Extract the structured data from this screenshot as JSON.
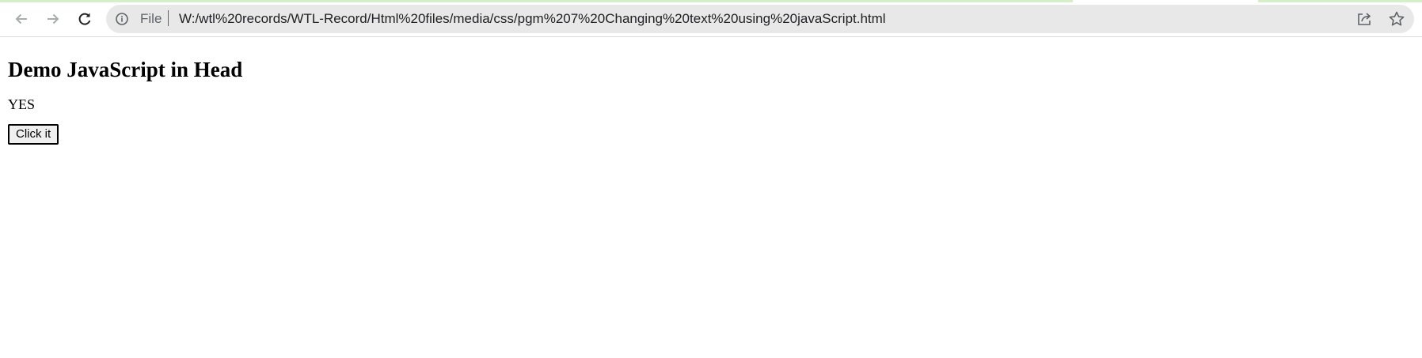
{
  "browser": {
    "address_bar": {
      "scheme_label": "File",
      "url": "W:/wtl%20records/WTL-Record/Html%20files/media/css/pgm%207%20Changing%20text%20using%20javaScript.html"
    },
    "icons": {
      "back": "arrow-left-icon",
      "forward": "arrow-right-icon",
      "reload": "reload-icon",
      "info": "info-icon",
      "share": "share-icon",
      "bookmark": "star-icon"
    },
    "colors": {
      "toolbar_background": "#ffffff",
      "omnibox_background": "#e8e8e8",
      "icon_color": "#5f6368",
      "load_progress": "#d5f0c8"
    }
  },
  "page": {
    "heading": "Demo JavaScript in Head",
    "result_text": "YES",
    "button_label": "Click it"
  }
}
